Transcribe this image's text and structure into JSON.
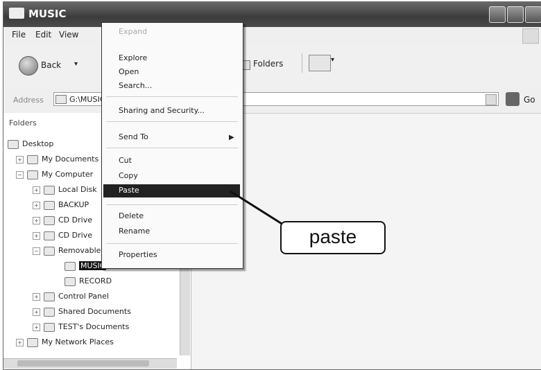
{
  "window": {
    "title": "MUSIC"
  },
  "menubar": {
    "items": [
      "File",
      "Edit",
      "View"
    ]
  },
  "toolbar": {
    "back_label": "Back",
    "back_dropdown": "▾",
    "folders_label": "Folders",
    "views_dropdown": "▾"
  },
  "addressbar": {
    "label": "Address",
    "value": "G:\\MUSIC",
    "go_label": "Go"
  },
  "folders_pane": {
    "header": "Folders",
    "items": [
      {
        "label": "Desktop",
        "icon": "desktop-icon"
      },
      {
        "label": "My Documents",
        "icon": "folder-icon"
      },
      {
        "label": "My Computer",
        "icon": "computer-icon"
      },
      {
        "label": "Local Disk",
        "icon": "drive-icon"
      },
      {
        "label": "BACKUP",
        "icon": "drive-icon"
      },
      {
        "label": "CD Drive",
        "icon": "cd-icon"
      },
      {
        "label": "CD Drive",
        "icon": "cd-icon"
      },
      {
        "label": "Removable Disk",
        "icon": "removable-drive-icon"
      },
      {
        "label": "MUSIC",
        "icon": "folder-icon",
        "selected": true
      },
      {
        "label": "RECORD",
        "icon": "folder-icon"
      },
      {
        "label": "Control Panel",
        "icon": "control-panel-icon"
      },
      {
        "label": "Shared Documents",
        "icon": "folder-icon"
      },
      {
        "label": "TEST's Documents",
        "icon": "folder-icon"
      },
      {
        "label": "My Network Places",
        "icon": "network-icon"
      }
    ]
  },
  "context_menu": {
    "items": [
      {
        "label": "Expand",
        "disabled": true
      },
      {
        "label": "Explore"
      },
      {
        "label": "Open"
      },
      {
        "label": "Search..."
      },
      {
        "label": "Sharing and Security..."
      },
      {
        "label": "Send To",
        "submenu": true
      },
      {
        "label": "Cut"
      },
      {
        "label": "Copy"
      },
      {
        "label": "Paste",
        "highlighted": true
      },
      {
        "label": "Delete"
      },
      {
        "label": "Rename"
      },
      {
        "label": "Properties"
      }
    ],
    "submenu_arrow": "▶"
  },
  "callout": {
    "text": "paste"
  },
  "colors": {
    "titlebar": "#4a4a4a",
    "highlight": "#222222",
    "selection": "#111111"
  }
}
